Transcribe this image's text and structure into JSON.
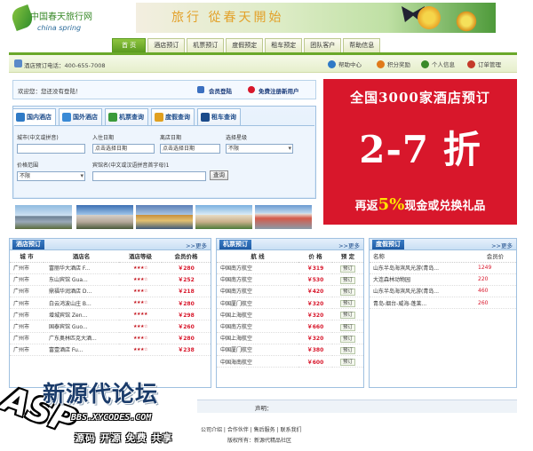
{
  "header": {
    "logo_text": "中国春天旅行网",
    "logo_sub": "china spring",
    "banner_text": "旅行 從春天開始"
  },
  "nav": {
    "tabs": [
      "首 页",
      "酒店预订",
      "机票预订",
      "度假预定",
      "租车预定",
      "团队客户",
      "帮助信息"
    ],
    "active": 0
  },
  "subbar": {
    "phone": "酒店预订电话：400-655-7008",
    "links": [
      {
        "label": "帮助中心",
        "icon": "help-icon",
        "color": "#2f7ac6"
      },
      {
        "label": "积分奖励",
        "icon": "star-icon",
        "color": "#e07a1a"
      },
      {
        "label": "个人信息",
        "icon": "user-icon",
        "color": "#3a8a2a"
      },
      {
        "label": "订单管理",
        "icon": "cart-icon",
        "color": "#c43a2a"
      }
    ]
  },
  "welcome": {
    "text": "欢迎您：您还没有登陆！",
    "login": "会员登陆",
    "register": "免费注册新用户"
  },
  "search": {
    "tabs": [
      "国内酒店",
      "国外酒店",
      "机票查询",
      "度假查询",
      "租车查询"
    ],
    "city_label": "城市(中文或拼音)",
    "checkin_label": "入住日期",
    "checkin_placeholder": "点击选择日期",
    "checkout_label": "离店日期",
    "checkout_placeholder": "点击选择日期",
    "star_label": "选择星级",
    "star_value": "不限",
    "price_label": "价格范围",
    "price_value": "不限",
    "name_label": "宾馆名(中文或汉语拼音首字母)1",
    "query_button": "查询"
  },
  "promo": {
    "title": "全国3000家酒店预订",
    "discount": "2-7 折",
    "bottom_prefix": "再返",
    "bottom_percent": "5%",
    "bottom_suffix": "现金或兑换礼品"
  },
  "hotel_panel": {
    "title": "酒店预订",
    "more": ">>更多",
    "headers": [
      "城 市",
      "酒店名",
      "酒店等级",
      "会员价格"
    ],
    "rows": [
      {
        "city": "广州市",
        "name": "富丽华大酒店 F...",
        "stars": "★★★☆",
        "price": "￥280"
      },
      {
        "city": "广州市",
        "name": "东山宾馆 Gua...",
        "stars": "★★★☆",
        "price": "￥252"
      },
      {
        "city": "广州市",
        "name": "鼎福华润酒店 D...",
        "stars": "★★★☆",
        "price": "￥218"
      },
      {
        "city": "广州市",
        "name": "白云鸿波山庄 B...",
        "stars": "★★★☆",
        "price": "￥280"
      },
      {
        "city": "广州市",
        "name": "增城宾馆 Zen...",
        "stars": "★★★★",
        "price": "￥298"
      },
      {
        "city": "广州市",
        "name": "国泰宾馆 Guo...",
        "stars": "★★★☆",
        "price": "￥260"
      },
      {
        "city": "广州市",
        "name": "广东奥林匹克大酒...",
        "stars": "★★★☆",
        "price": "￥280"
      },
      {
        "city": "广州市",
        "name": "富壹酒店 Fu...",
        "stars": "★★★☆",
        "price": "￥238"
      }
    ]
  },
  "flight_panel": {
    "title": "机票预订",
    "more": ">>更多",
    "headers": [
      "航 线",
      "价 格",
      "预 定"
    ],
    "book_label": "预订",
    "rows": [
      {
        "route": "中国南方航空",
        "price": "￥319"
      },
      {
        "route": "中国南方航空",
        "price": "￥530"
      },
      {
        "route": "中国南方航空",
        "price": "￥420"
      },
      {
        "route": "中国厦门航空",
        "price": "￥320"
      },
      {
        "route": "中国上海航空",
        "price": "￥320"
      },
      {
        "route": "中国南方航空",
        "price": "￥660"
      },
      {
        "route": "中国上海航空",
        "price": "￥320"
      },
      {
        "route": "中国厦门航空",
        "price": "￥380"
      },
      {
        "route": "中国海南航空",
        "price": "￥600"
      }
    ]
  },
  "holiday_panel": {
    "title": "度假预订",
    "more": ">>更多",
    "headers": [
      "名称",
      "会员价"
    ],
    "rows": [
      {
        "name": "山东半岛海滨风光游(青岛...",
        "price": "1249"
      },
      {
        "name": "大连森林动物园",
        "price": "220"
      },
      {
        "name": "山东半岛海滨风光游(青岛...",
        "price": "460"
      },
      {
        "name": "青岛-烟台-威海-蓬莱...",
        "price": "260"
      }
    ]
  },
  "footer": {
    "declaration": "声明：",
    "links": "公司介绍 | 合作伙伴 | 售后服务 | 联系我们",
    "copyright": "版权所有：新源代精品社区"
  },
  "watermark": {
    "site_name": "新源代论坛",
    "domain": "BBS.XYCODES.COM",
    "slogan": "源码 开源 免费 共享",
    "asp": "ASP"
  }
}
